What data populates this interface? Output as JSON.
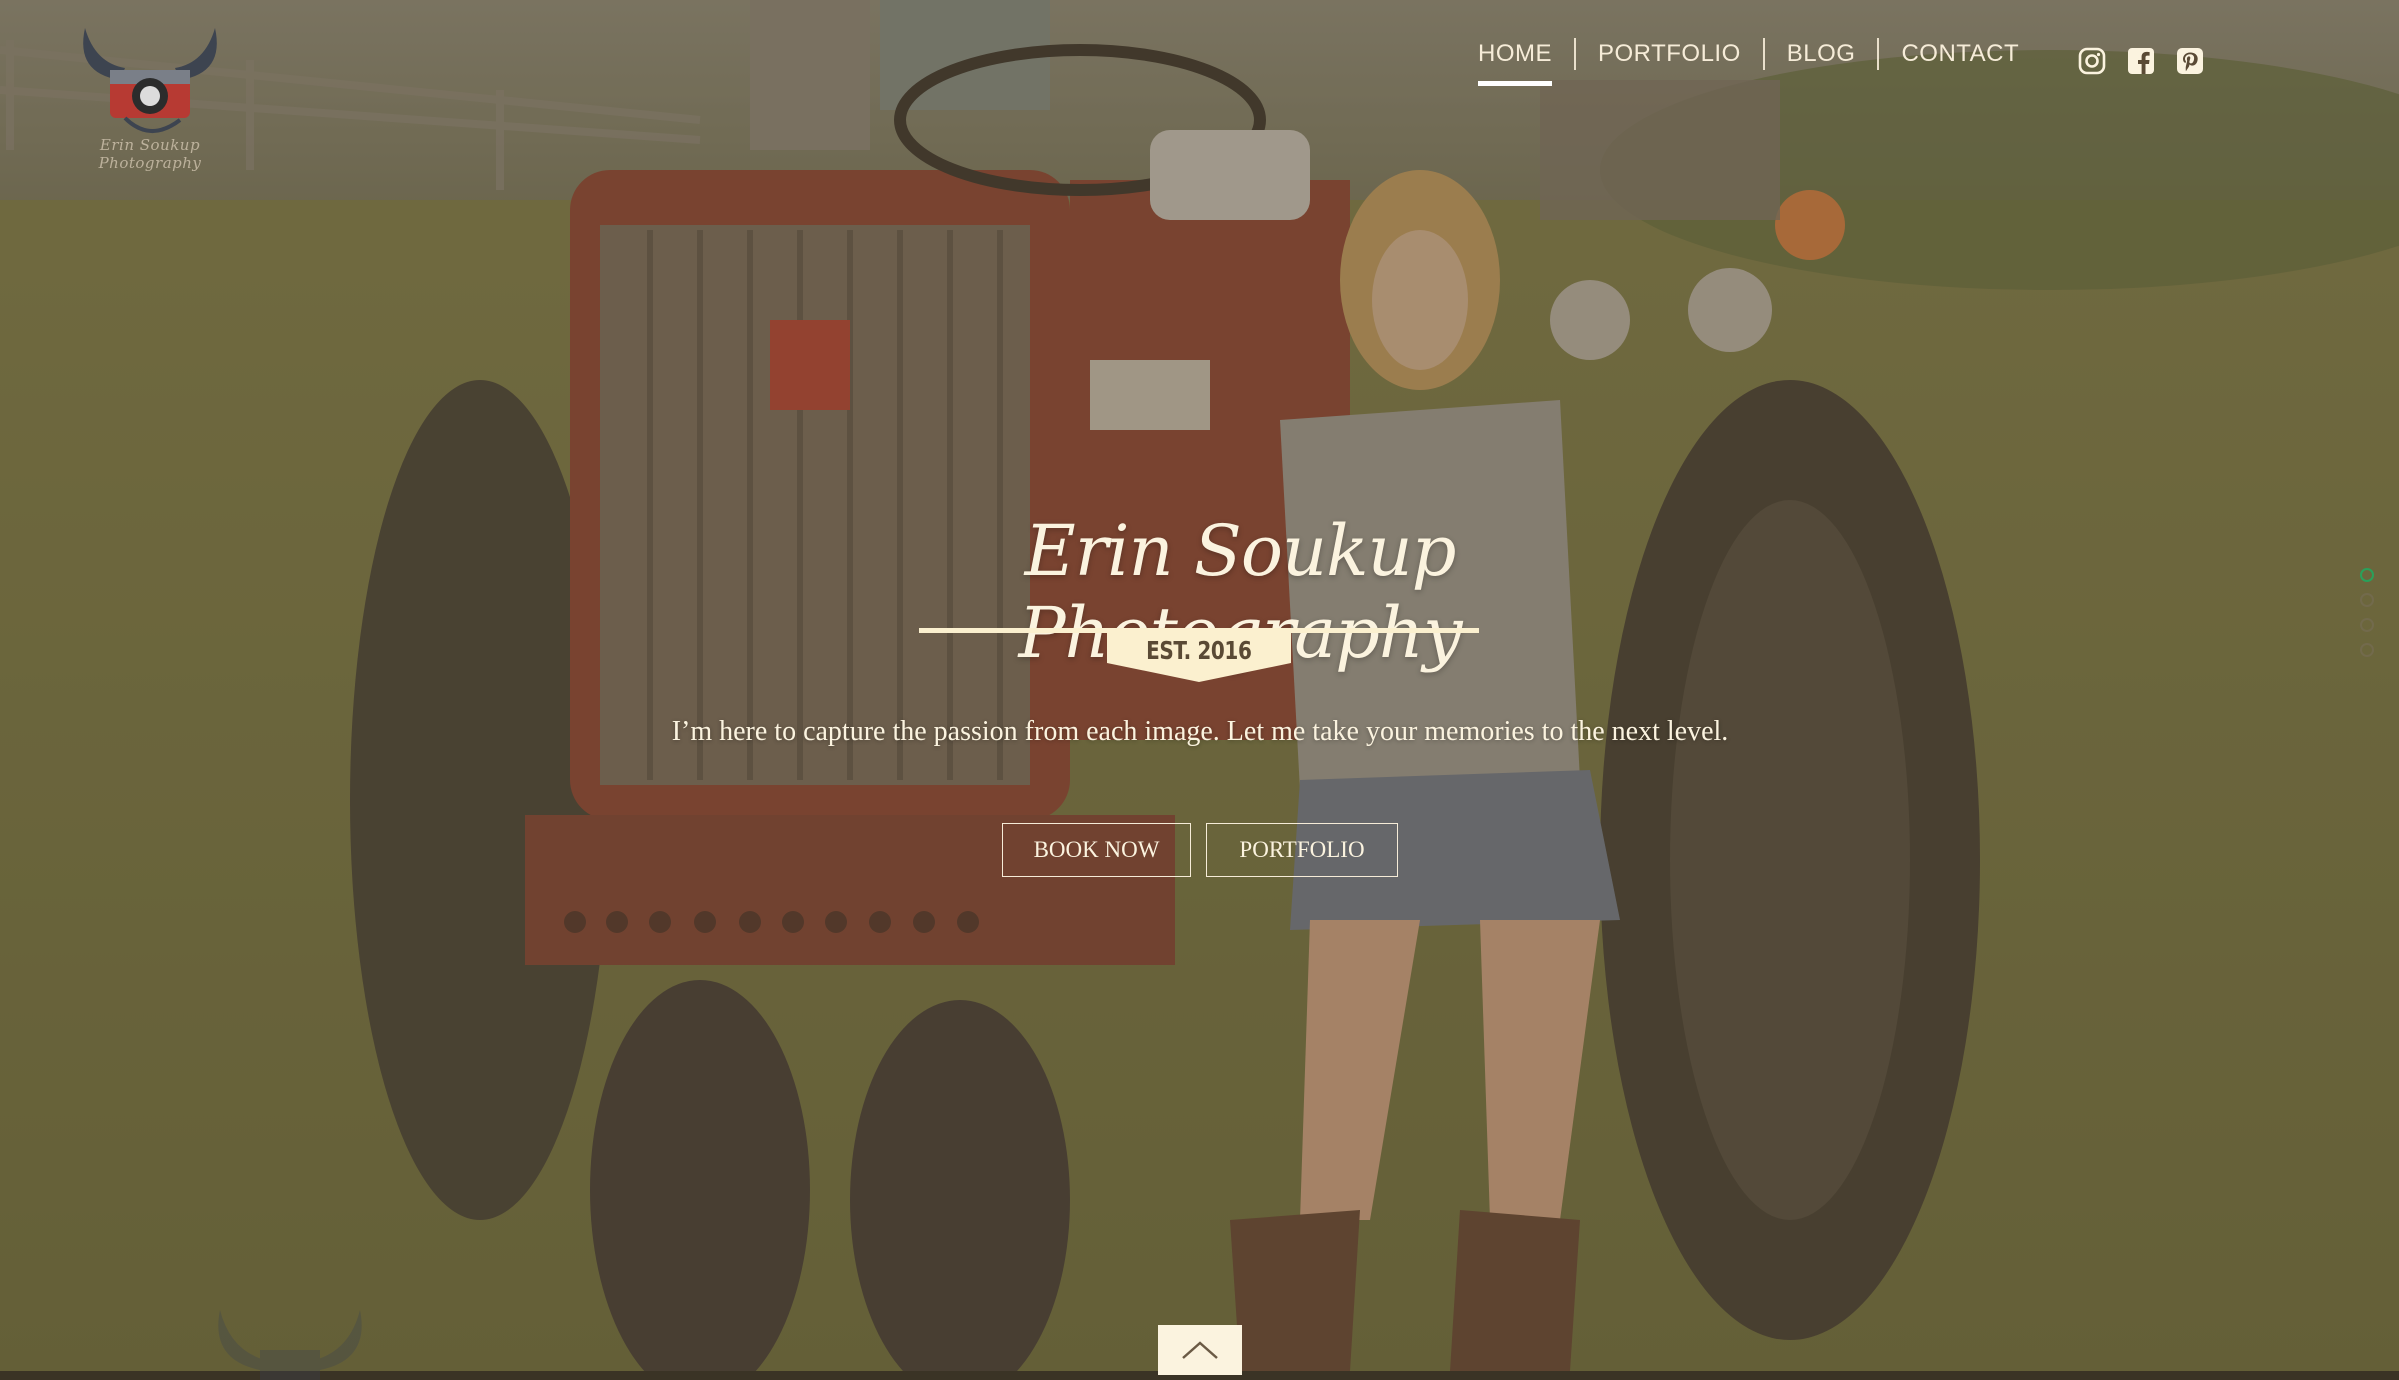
{
  "logo": {
    "caption": "Erin Soukup Photography",
    "icon": "camera-with-horns-logo"
  },
  "nav": {
    "items": [
      {
        "label": "HOME",
        "active": true
      },
      {
        "label": "PORTFOLIO",
        "active": false
      },
      {
        "label": "BLOG",
        "active": false
      },
      {
        "label": "CONTACT",
        "active": false
      }
    ]
  },
  "social": [
    {
      "icon": "instagram-icon"
    },
    {
      "icon": "facebook-icon"
    },
    {
      "icon": "pinterest-icon"
    }
  ],
  "hero": {
    "title": "Erin Soukup Photography",
    "established": "EST. 2016",
    "tagline": "I’m here to capture the passion from each image. Let me take your memories to the next level.",
    "buttons": {
      "book": "BOOK NOW",
      "portfolio": "PORTFOLIO"
    }
  },
  "slider": {
    "count": 4,
    "active_index": 0
  },
  "scroll_top": {
    "icon": "chevron-up-icon"
  },
  "colors": {
    "cream": "#fbf3df",
    "active_dot": "#2aa05a",
    "banner": "#fbf0cf",
    "overlay": "#5f4e37"
  }
}
